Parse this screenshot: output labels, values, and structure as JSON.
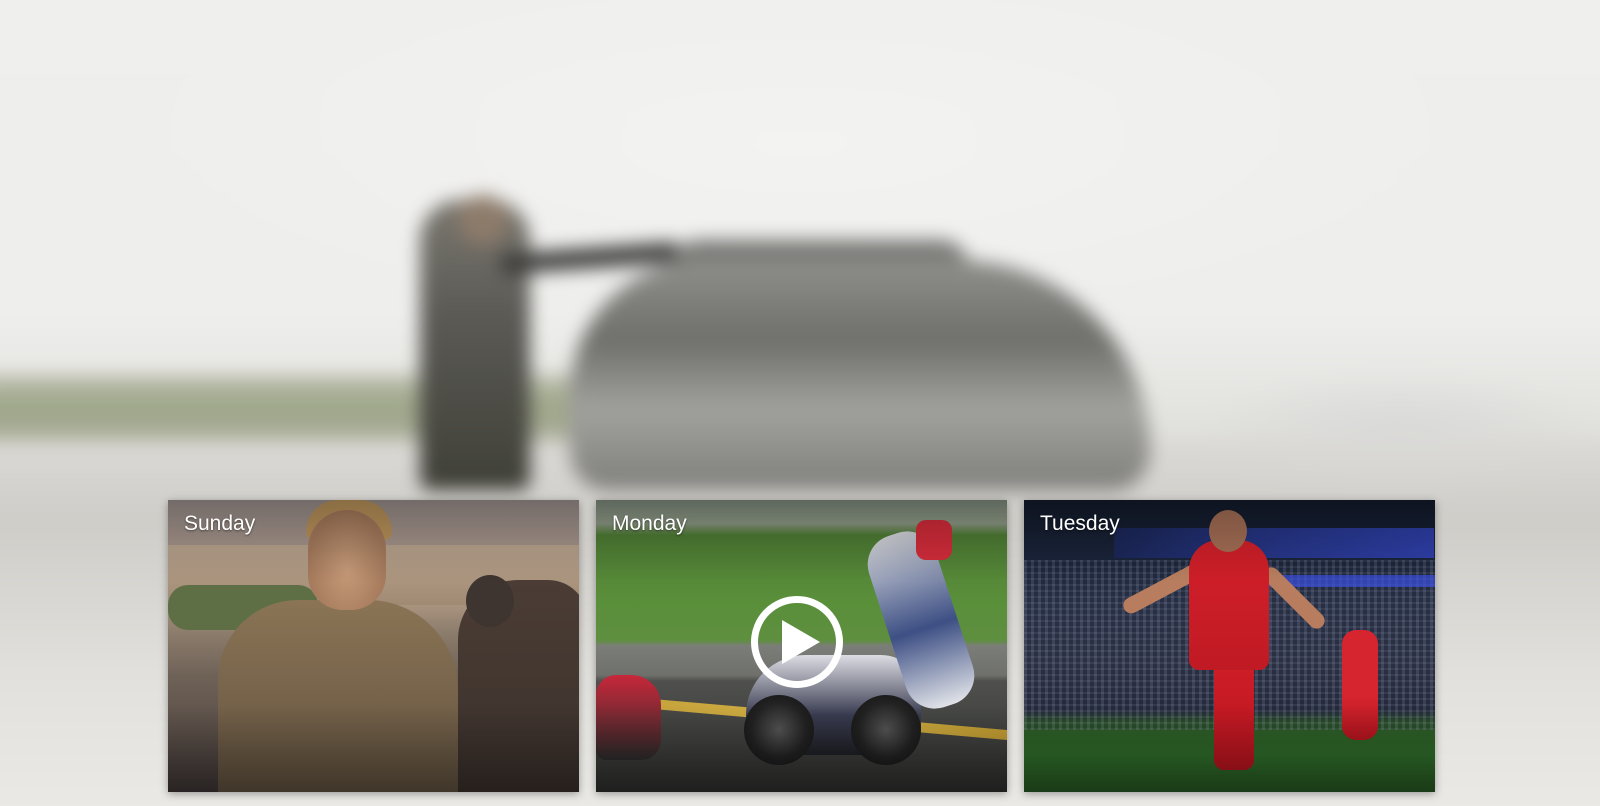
{
  "cards": [
    {
      "day": "Sunday",
      "has_video": false
    },
    {
      "day": "Monday",
      "has_video": true,
      "play_icon": "play-circle-icon"
    },
    {
      "day": "Tuesday",
      "has_video": false
    }
  ],
  "colors": {
    "label_text": "#ffffff",
    "play_icon": "#ffffff"
  }
}
